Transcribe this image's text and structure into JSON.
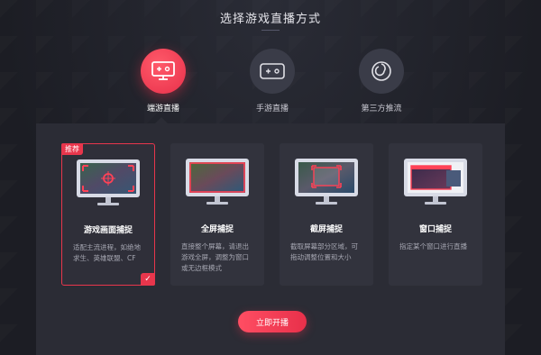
{
  "header": {
    "title": "选择游戏直播方式"
  },
  "modes": [
    {
      "label": "端游直播",
      "icon": "pc-game-icon",
      "active": true
    },
    {
      "label": "手游直播",
      "icon": "mobile-game-icon",
      "active": false
    },
    {
      "label": "第三方推流",
      "icon": "obs-icon",
      "active": false
    }
  ],
  "cards": [
    {
      "badge": "推荐",
      "title": "游戏画面捕捉",
      "desc": "适配主流进程，如绝地求生、英雄联盟、CF",
      "check": "✓"
    },
    {
      "title": "全屏捕捉",
      "desc": "直接整个屏幕，请退出游戏全屏，调整为窗口或无边框模式"
    },
    {
      "title": "截屏捕捉",
      "desc": "截取屏幕部分区域，可拖动调整位置和大小"
    },
    {
      "title": "窗口捕捉",
      "desc": "指定某个窗口进行直播"
    }
  ],
  "actions": {
    "start_label": "立即开播"
  },
  "colors": {
    "accent": "#e8364c",
    "panel": "#2b2c35",
    "background": "#1f2027"
  }
}
